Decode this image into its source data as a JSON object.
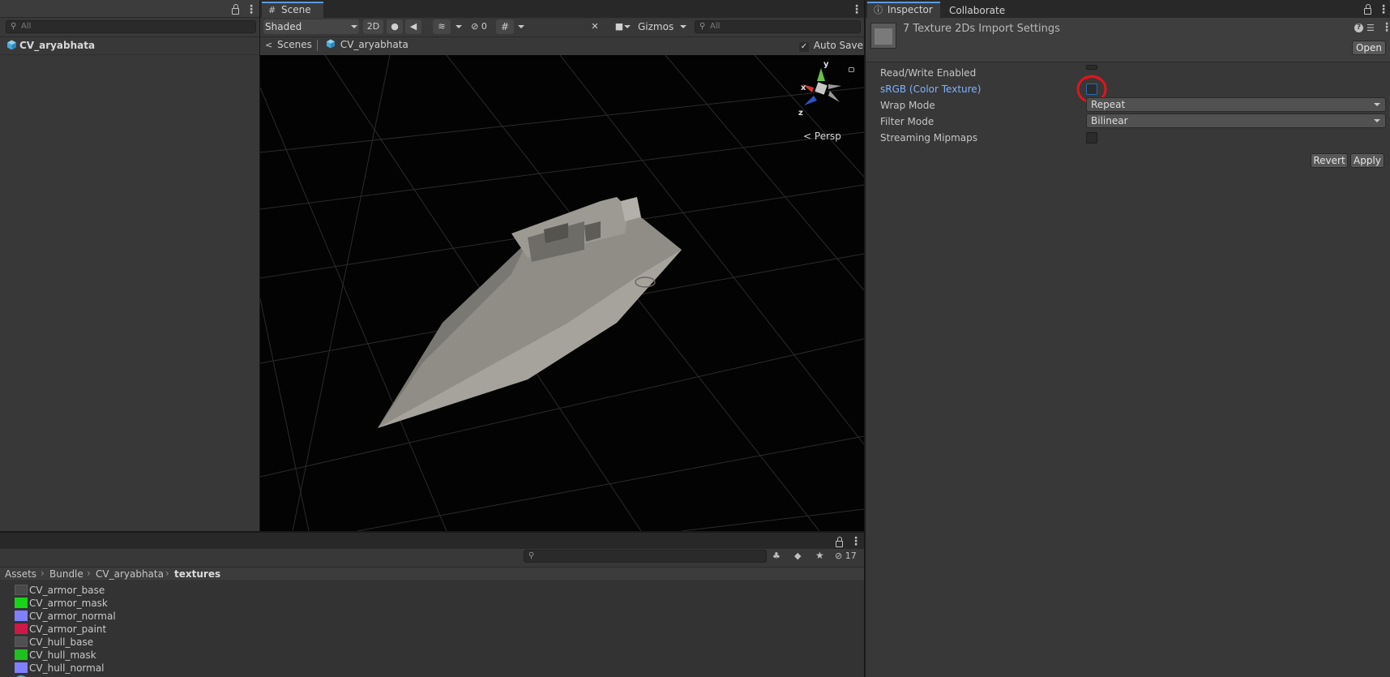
{
  "hierarchy": {
    "search_placeholder": "All",
    "root_item": "CV_aryabhata"
  },
  "scene": {
    "tab_label": "Scene",
    "shading_mode": "Shaded",
    "btn_2d": "2D",
    "hidden_count": "0",
    "gizmos_label": "Gizmos",
    "search_placeholder": "All",
    "breadcrumb_root": "Scenes",
    "breadcrumb_item": "CV_aryabhata",
    "auto_save_label": "Auto Save",
    "projection_label": "Persp",
    "axis_y": "y",
    "axis_x": "x",
    "axis_z": "z"
  },
  "inspector": {
    "tab_label": "Inspector",
    "tab_collaborate": "Collaborate",
    "header_title": "7 Texture 2Ds Import Settings",
    "open_button": "Open",
    "fields": {
      "read_write": "Read/Write Enabled",
      "srgb": "sRGB (Color Texture)",
      "wrap_mode": "Wrap Mode",
      "wrap_mode_value": "Repeat",
      "filter_mode": "Filter Mode",
      "filter_mode_value": "Bilinear",
      "streaming_mipmaps": "Streaming Mipmaps"
    },
    "revert_button": "Revert",
    "apply_button": "Apply"
  },
  "project": {
    "hidden_count": "17",
    "breadcrumb": [
      "Assets",
      "Bundle",
      "CV_aryabhata",
      "textures"
    ],
    "assets": [
      {
        "name": "CV_armor_base",
        "thumb_color": "#4a4a4a"
      },
      {
        "name": "CV_armor_mask",
        "thumb_color": "#18d418"
      },
      {
        "name": "CV_armor_normal",
        "thumb_color": "#8080ff"
      },
      {
        "name": "CV_armor_paint",
        "thumb_color": "#d01848"
      },
      {
        "name": "CV_hull_base",
        "thumb_color": "#505050"
      },
      {
        "name": "CV_hull_mask",
        "thumb_color": "#20c020"
      },
      {
        "name": "CV_hull_normal",
        "thumb_color": "#8080ff"
      }
    ]
  },
  "colors": {
    "accent_blue": "#5a9ae0",
    "srgb_label": "#7fb2ff",
    "highlight_ring": "#e0141e"
  }
}
